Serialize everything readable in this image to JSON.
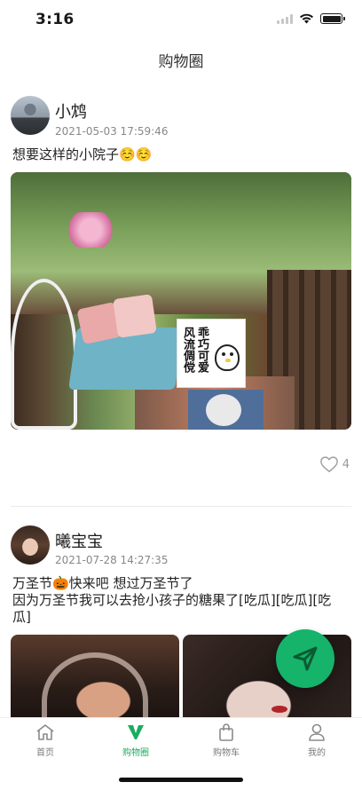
{
  "status_bar": {
    "time": "3:16"
  },
  "nav": {
    "title": "购物圈"
  },
  "posts": [
    {
      "user": "小鸩",
      "time": "2021-05-03 17:59:46",
      "text": "想要这样的小院子☺️☺️",
      "sticker": {
        "left": "风流倜傥",
        "right": "乖巧可爱"
      },
      "likes": "4"
    },
    {
      "user": "曦宝宝",
      "time": "2021-07-28 14:27:35",
      "text_line1": "万圣节🎃快来吧  想过万圣节了",
      "text_line2": "因为万圣节我可以去抢小孩子的糖果了[吃瓜][吃瓜][吃瓜]"
    }
  ],
  "tab_bar": {
    "items": [
      {
        "label": "首页"
      },
      {
        "label": "购物圈"
      },
      {
        "label": "购物车"
      },
      {
        "label": "我的"
      }
    ]
  },
  "colors": {
    "accent": "#1aad62",
    "fab": "#16b36b"
  }
}
